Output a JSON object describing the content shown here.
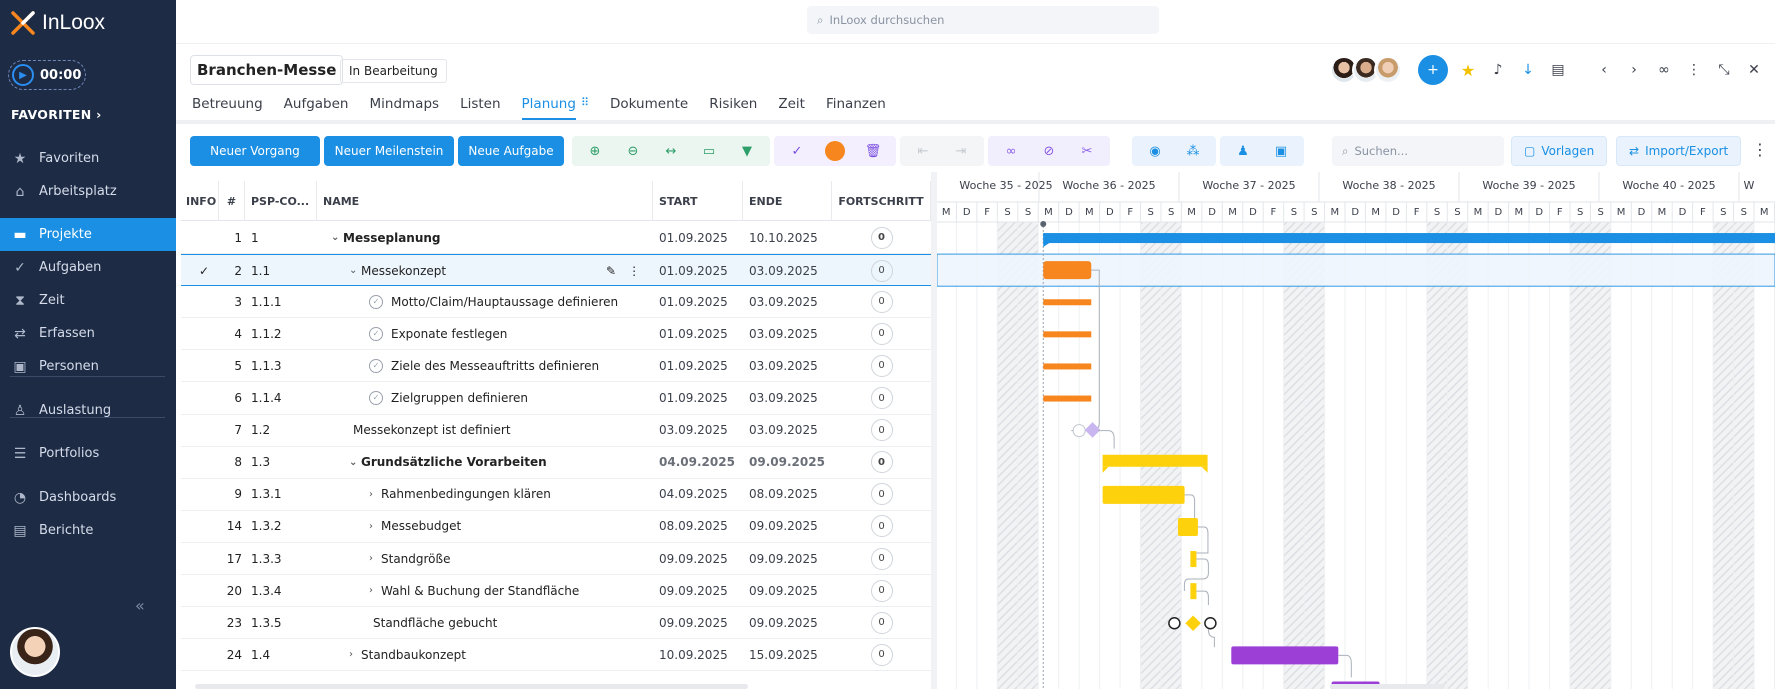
{
  "app": {
    "name": "InLoox",
    "search_placeholder": "InLoox durchsuchen"
  },
  "timer": "00:00",
  "sidebar": {
    "favorites_header": "FAVORITEN",
    "items": [
      {
        "label": "Favoriten",
        "icon": "star-icon"
      },
      {
        "label": "Arbeitsplatz",
        "icon": "home-icon"
      },
      {
        "label": "Projekte",
        "icon": "folder-icon",
        "active": true
      },
      {
        "label": "Aufgaben",
        "icon": "check-circle-icon"
      },
      {
        "label": "Zeit",
        "icon": "hourglass-icon"
      },
      {
        "label": "Erfassen",
        "icon": "swap-icon"
      },
      {
        "label": "Personen",
        "icon": "person-card-icon"
      },
      {
        "label": "Auslastung",
        "icon": "workload-icon"
      },
      {
        "label": "Portfolios",
        "icon": "portfolio-icon"
      },
      {
        "label": "Dashboards",
        "icon": "pie-icon"
      },
      {
        "label": "Berichte",
        "icon": "report-icon"
      }
    ]
  },
  "project": {
    "title": "Branchen-Messe",
    "status": "In Bearbeitung"
  },
  "tabs": [
    "Betreuung",
    "Aufgaben",
    "Mindmaps",
    "Listen",
    "Planung",
    "Dokumente",
    "Risiken",
    "Zeit",
    "Finanzen"
  ],
  "active_tab": "Planung",
  "toolbar": {
    "new_process": "Neuer Vorgang",
    "new_milestone": "Neuer Meilenstein",
    "new_task": "Neue Aufgabe",
    "search_placeholder": "Suchen...",
    "templates": "Vorlagen",
    "import_export": "Import/Export"
  },
  "colors": {
    "accent": "#1a8fe3",
    "sidebar": "#1d2b45",
    "orange": "#f7861f",
    "yellow": "#fdd20c",
    "purple": "#9b3fd6",
    "milestone_lilac": "#c9b6f0"
  },
  "columns": {
    "info": "INFO",
    "num": "#",
    "psp": "PSP-CO...",
    "name": "NAME",
    "start": "START",
    "end": "ENDE",
    "progress": "FORTSCHRITT"
  },
  "rows": [
    {
      "num": "1",
      "psp": "1",
      "name": "Messeplanung",
      "start": "01.09.2025",
      "end": "10.10.2025",
      "progress": "0",
      "level": 0,
      "type": "summary",
      "expand": "down"
    },
    {
      "num": "2",
      "psp": "1.1",
      "name": "Messekonzept",
      "start": "01.09.2025",
      "end": "03.09.2025",
      "progress": "0",
      "level": 1,
      "type": "group",
      "expand": "down",
      "selected": true
    },
    {
      "num": "3",
      "psp": "1.1.1",
      "name": "Motto/Claim/Hauptaussage definieren",
      "start": "01.09.2025",
      "end": "03.09.2025",
      "progress": "0",
      "level": 2,
      "type": "task"
    },
    {
      "num": "4",
      "psp": "1.1.2",
      "name": "Exponate festlegen",
      "start": "01.09.2025",
      "end": "03.09.2025",
      "progress": "0",
      "level": 2,
      "type": "task"
    },
    {
      "num": "5",
      "psp": "1.1.3",
      "name": "Ziele des Messeauftritts definieren",
      "start": "01.09.2025",
      "end": "03.09.2025",
      "progress": "0",
      "level": 2,
      "type": "task"
    },
    {
      "num": "6",
      "psp": "1.1.4",
      "name": "Zielgruppen definieren",
      "start": "01.09.2025",
      "end": "03.09.2025",
      "progress": "0",
      "level": 2,
      "type": "task"
    },
    {
      "num": "7",
      "psp": "1.2",
      "name": "Messekonzept ist definiert",
      "start": "03.09.2025",
      "end": "03.09.2025",
      "progress": "0",
      "level": 1,
      "type": "milestone"
    },
    {
      "num": "8",
      "psp": "1.3",
      "name": "Grundsätzliche Vorarbeiten",
      "start": "04.09.2025",
      "end": "09.09.2025",
      "progress": "0",
      "level": 1,
      "type": "summary",
      "expand": "down"
    },
    {
      "num": "9",
      "psp": "1.3.1",
      "name": "Rahmenbedingungen klären",
      "start": "04.09.2025",
      "end": "08.09.2025",
      "progress": "0",
      "level": 2,
      "type": "group",
      "expand": "right"
    },
    {
      "num": "14",
      "psp": "1.3.2",
      "name": "Messebudget",
      "start": "08.09.2025",
      "end": "09.09.2025",
      "progress": "0",
      "level": 2,
      "type": "group",
      "expand": "right"
    },
    {
      "num": "17",
      "psp": "1.3.3",
      "name": "Standgröße",
      "start": "09.09.2025",
      "end": "09.09.2025",
      "progress": "0",
      "level": 2,
      "type": "group",
      "expand": "right"
    },
    {
      "num": "20",
      "psp": "1.3.4",
      "name": "Wahl & Buchung der Standfläche",
      "start": "09.09.2025",
      "end": "09.09.2025",
      "progress": "0",
      "level": 2,
      "type": "group",
      "expand": "right"
    },
    {
      "num": "23",
      "psp": "1.3.5",
      "name": "Standfläche gebucht",
      "start": "09.09.2025",
      "end": "09.09.2025",
      "progress": "0",
      "level": 2,
      "type": "milestone"
    },
    {
      "num": "24",
      "psp": "1.4",
      "name": "Standbaukonzept",
      "start": "10.09.2025",
      "end": "15.09.2025",
      "progress": "0",
      "level": 1,
      "type": "group",
      "expand": "right"
    }
  ],
  "gantt": {
    "weeks": [
      "Woche 35 - 2025",
      "Woche 36 - 2025",
      "Woche 37 - 2025",
      "Woche 38 - 2025",
      "Woche 39 - 2025",
      "Woche 40 - 2025",
      "W"
    ],
    "days": [
      "M",
      "D",
      "F",
      "S",
      "S",
      "M",
      "D",
      "M",
      "D",
      "F",
      "S",
      "S",
      "M",
      "D",
      "M",
      "D",
      "F",
      "S",
      "S",
      "M",
      "D",
      "M",
      "D",
      "F",
      "S",
      "S",
      "M",
      "D",
      "M",
      "D",
      "F",
      "S",
      "S",
      "M",
      "D",
      "M",
      "D",
      "F",
      "S",
      "S",
      "M",
      "D",
      "M",
      "D",
      "F",
      "S",
      "S",
      "M"
    ]
  }
}
